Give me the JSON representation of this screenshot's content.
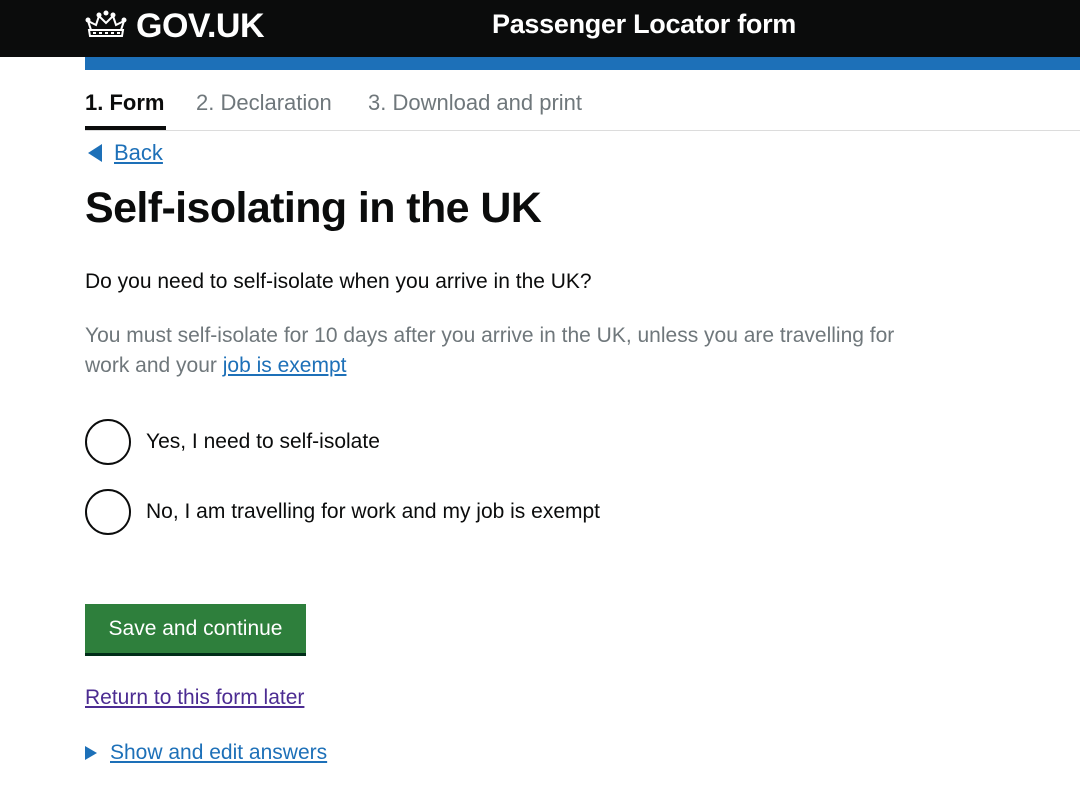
{
  "header": {
    "logo_text": "GOV.UK",
    "service_name": "Passenger Locator form"
  },
  "steps": [
    {
      "label": "1. Form",
      "current": true
    },
    {
      "label": "2. Declaration",
      "current": false
    },
    {
      "label": "3. Download and print",
      "current": false
    }
  ],
  "back_link": "Back",
  "page_title": "Self-isolating in the UK",
  "question": "Do you need to self-isolate when you arrive in the UK?",
  "hint": {
    "text": "You must self-isolate for 10 days after you arrive in the UK, unless you are travelling for work and your",
    "link": "job is exempt"
  },
  "options": [
    {
      "label": "Yes, I need to self-isolate",
      "selected": false
    },
    {
      "label": "No, I am travelling for work and my job is exempt",
      "selected": false
    }
  ],
  "submit_button": "Save and continue",
  "return_link": "Return to this form later",
  "details_summary": "Show and edit answers",
  "colors": {
    "header_bg": "#0b0c0c",
    "accent_blue": "#1d70b8",
    "button_green": "#2e7f3c",
    "visited_link": "#4c2c92"
  }
}
